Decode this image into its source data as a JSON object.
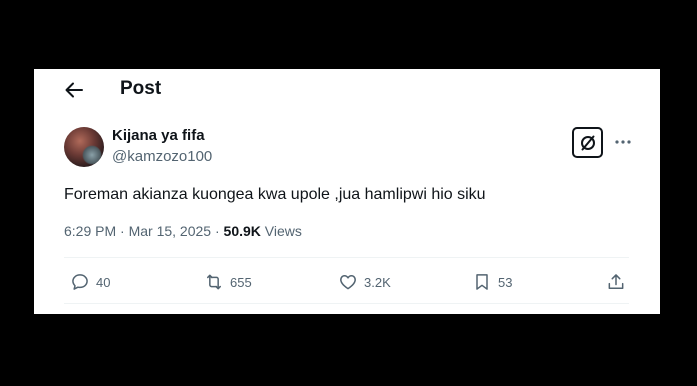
{
  "header": {
    "title": "Post"
  },
  "post": {
    "author_name": "Kijana ya fifa",
    "author_handle": "@kamzozo100",
    "text": "Foreman akianza kuongea kwa upole ,jua hamlipwi hio siku",
    "timestamp": "6:29 PM · Mar 15, 2025 · ",
    "views_count": "50.9K",
    "views_label": " Views"
  },
  "actions": {
    "replies": "40",
    "reposts": "655",
    "likes": "3.2K",
    "bookmarks": "53"
  },
  "icons": {
    "back": "arrow-left-icon",
    "grok": "grok-icon",
    "more": "more-dots-icon",
    "reply": "reply-icon",
    "repost": "repost-icon",
    "like": "heart-icon",
    "bookmark": "bookmark-icon",
    "share": "share-icon"
  }
}
